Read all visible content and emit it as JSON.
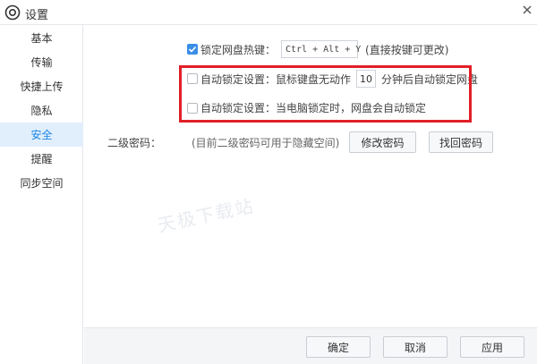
{
  "window": {
    "title": "设置",
    "icon": "settings-logo-icon"
  },
  "sidebar": {
    "items": [
      {
        "label": "基本"
      },
      {
        "label": "传输"
      },
      {
        "label": "快捷上传"
      },
      {
        "label": "隐私"
      },
      {
        "label": "安全",
        "active": true
      },
      {
        "label": "提醒"
      },
      {
        "label": "同步空间"
      }
    ]
  },
  "security": {
    "hotkey": {
      "checked": true,
      "label": "锁定网盘热键：",
      "value": "Ctrl + Alt + Y",
      "hint": "(直接按键可更改)"
    },
    "auto_lock_idle": {
      "checked": false,
      "label": "自动锁定设置：鼠标键盘无动作",
      "minutes": "10",
      "suffix": "分钟后自动锁定网盘"
    },
    "auto_lock_pc": {
      "checked": false,
      "label": "自动锁定设置：当电脑锁定时，网盘会自动锁定"
    },
    "second_password": {
      "label": "二级密码：",
      "hint": "(目前二级密码可用于隐藏空间)",
      "change_button": "修改密码",
      "recover_button": "找回密码"
    }
  },
  "watermark": "天极下载站",
  "footer": {
    "ok": "确定",
    "cancel": "取消",
    "apply": "应用"
  },
  "colors": {
    "accent": "#1a86e8",
    "active_bg": "#e1eefc",
    "highlight_border": "#e11f27"
  }
}
